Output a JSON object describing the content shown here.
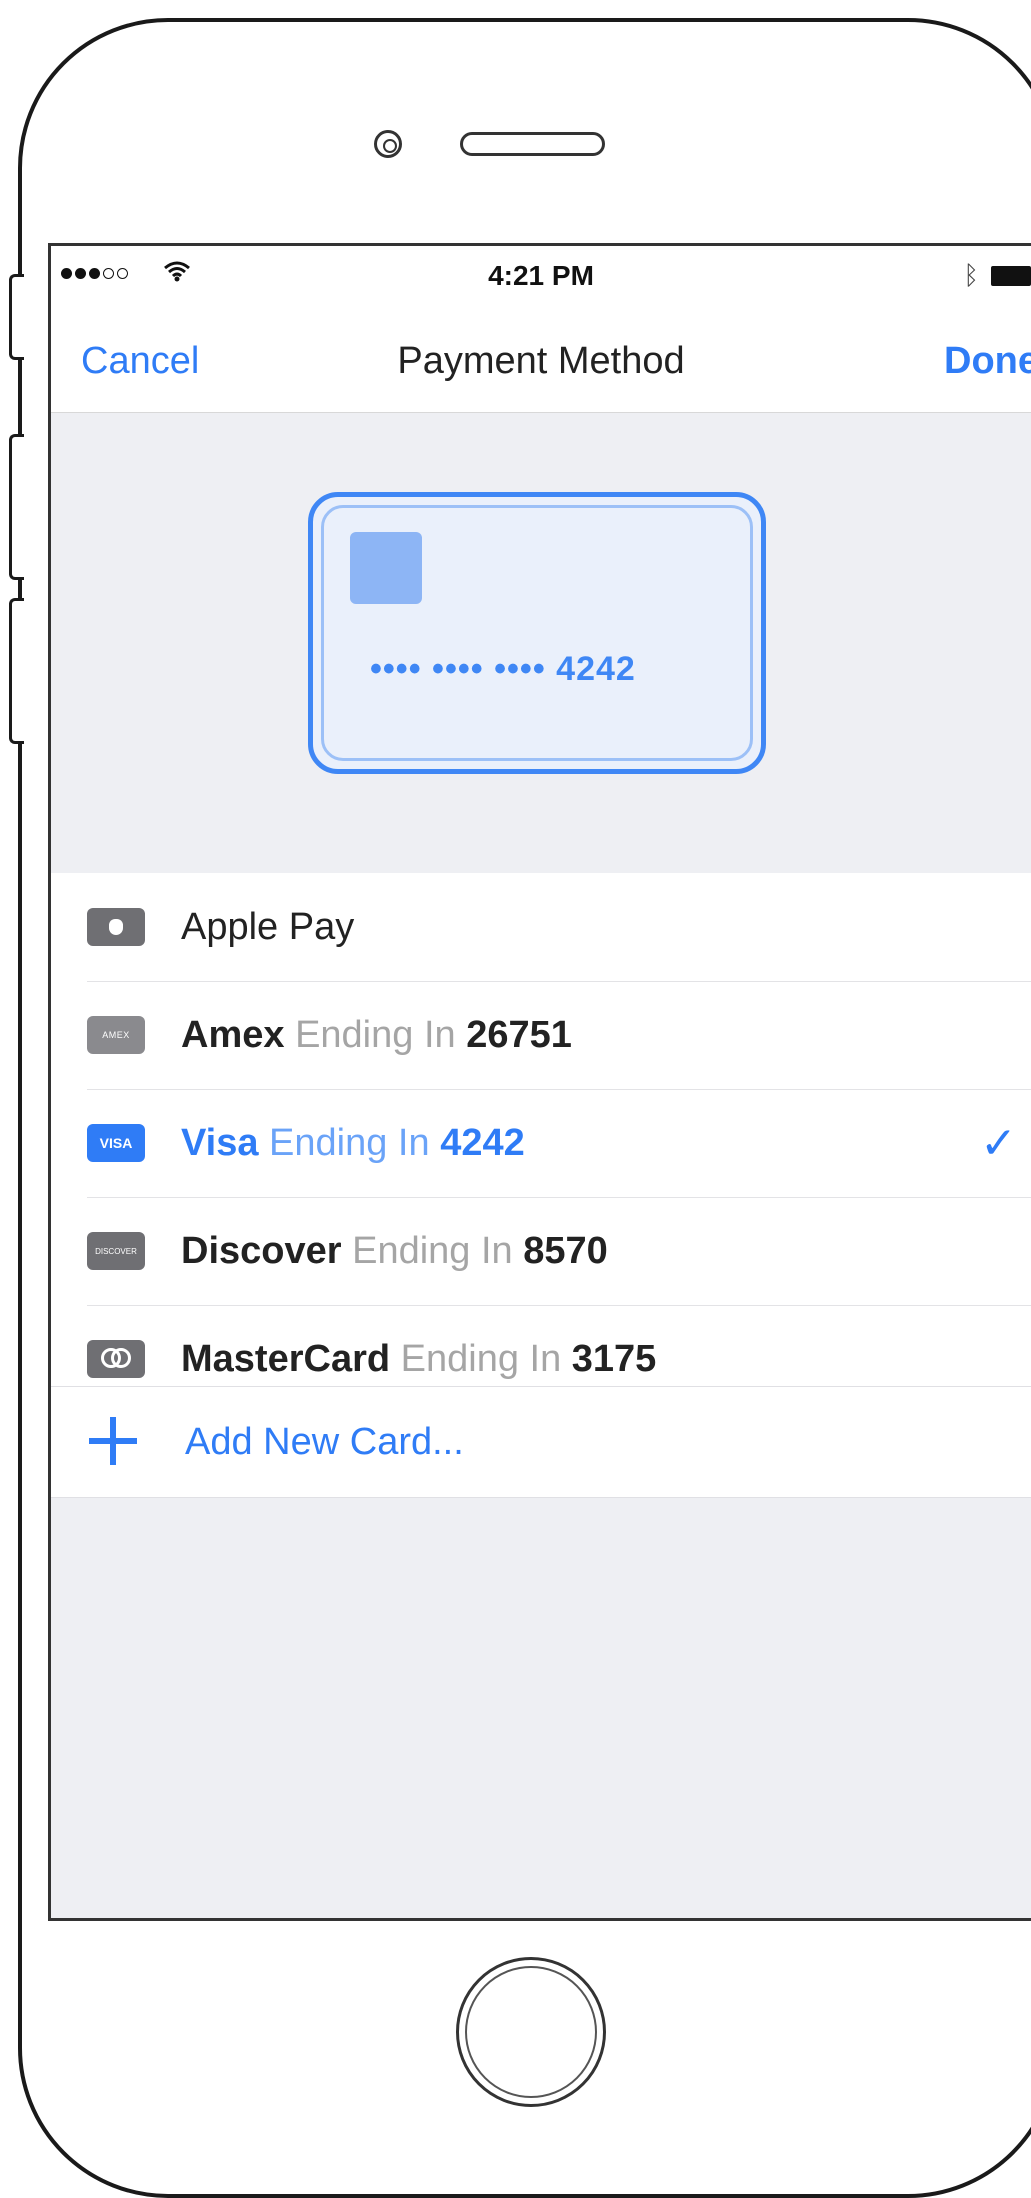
{
  "status": {
    "time": "4:21 PM"
  },
  "nav": {
    "cancel": "Cancel",
    "title": "Payment Method",
    "done": "Done"
  },
  "card_preview": {
    "number": "•••• •••• •••• 4242"
  },
  "payment_methods": [
    {
      "icon": "apple-pay-icon",
      "brand": "Apple Pay",
      "ending_label": "",
      "number": ""
    },
    {
      "icon": "amex-icon",
      "brand": "Amex",
      "ending_label": "Ending In",
      "number": "26751",
      "icon_text": "AMEX"
    },
    {
      "icon": "visa-icon",
      "brand": "Visa",
      "ending_label": "Ending In",
      "number": "4242",
      "icon_text": "VISA",
      "selected": true
    },
    {
      "icon": "discover-icon",
      "brand": "Discover",
      "ending_label": "Ending In",
      "number": "8570",
      "icon_text": "DISCOVER"
    },
    {
      "icon": "mastercard-icon",
      "brand": "MasterCard",
      "ending_label": "Ending In",
      "number": "3175"
    }
  ],
  "selected_checkmark": "✓",
  "add_card": {
    "label": "Add New Card..."
  },
  "colors": {
    "accent": "#2f7cf6",
    "background": "#eeeff3",
    "muted_text": "#a5a5a5"
  }
}
